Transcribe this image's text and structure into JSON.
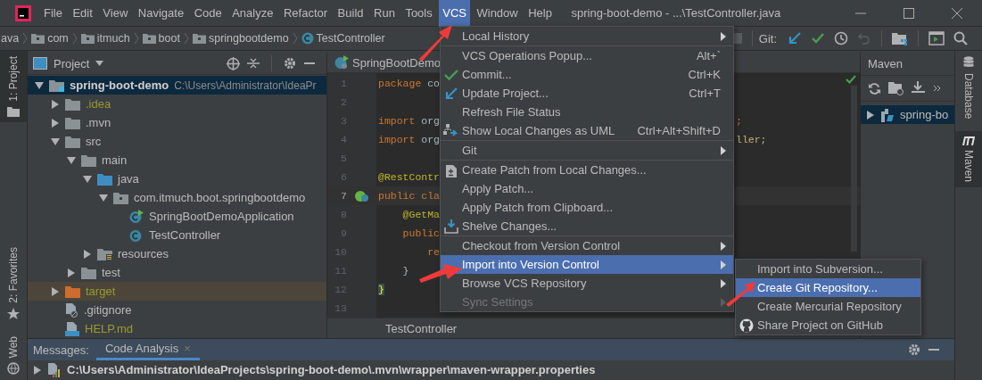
{
  "window": {
    "title": "spring-boot-demo - ...\\TestController.java"
  },
  "menu_bar": [
    {
      "label": "File",
      "selected": false
    },
    {
      "label": "Edit",
      "selected": false
    },
    {
      "label": "View",
      "selected": false
    },
    {
      "label": "Navigate",
      "selected": false
    },
    {
      "label": "Code",
      "selected": false
    },
    {
      "label": "Analyze",
      "selected": false
    },
    {
      "label": "Refactor",
      "selected": false
    },
    {
      "label": "Build",
      "selected": false
    },
    {
      "label": "Run",
      "selected": false
    },
    {
      "label": "Tools",
      "selected": false
    },
    {
      "label": "VCS",
      "selected": true
    },
    {
      "label": "Window",
      "selected": false
    },
    {
      "label": "Help",
      "selected": false
    }
  ],
  "breadcrumb": [
    {
      "label": "ava",
      "kind": "text"
    },
    {
      "label": "com",
      "kind": "folder"
    },
    {
      "label": "itmuch",
      "kind": "folder"
    },
    {
      "label": "boot",
      "kind": "folder"
    },
    {
      "label": "springbootdemo",
      "kind": "folder"
    },
    {
      "label": "TestController",
      "kind": "class"
    }
  ],
  "toolbar": {
    "git_label": "Git:"
  },
  "left_stripe": [
    {
      "label": "1: Project",
      "selected": true,
      "kind": "project"
    },
    {
      "label": "2: Favorites",
      "selected": false,
      "kind": "favorites"
    },
    {
      "label": "Web",
      "selected": false,
      "kind": "web"
    }
  ],
  "project": {
    "title": "Project",
    "tree": [
      {
        "label": "spring-boot-demo",
        "path": "C:\\Users\\Administrator\\IdeaPr",
        "kind": "module",
        "expanded": true,
        "selected": true,
        "ignored": false,
        "children": [
          {
            "label": ".idea",
            "kind": "folder",
            "expanded": false,
            "selected": false,
            "ignored": true
          },
          {
            "label": ".mvn",
            "kind": "folder",
            "expanded": false,
            "selected": false,
            "ignored": false
          },
          {
            "label": "src",
            "kind": "folder",
            "expanded": true,
            "selected": false,
            "ignored": false,
            "children": [
              {
                "label": "main",
                "kind": "folder",
                "expanded": true,
                "selected": false,
                "ignored": false,
                "children": [
                  {
                    "label": "java",
                    "kind": "source-folder",
                    "expanded": true,
                    "selected": false,
                    "ignored": false,
                    "children": [
                      {
                        "label": "com.itmuch.boot.springbootdemo",
                        "kind": "package",
                        "expanded": true,
                        "selected": false,
                        "ignored": false,
                        "children": [
                          {
                            "label": "SpringBootDemoApplication",
                            "kind": "spring-class",
                            "selected": false,
                            "ignored": false
                          },
                          {
                            "label": "TestController",
                            "kind": "class",
                            "selected": false,
                            "ignored": false
                          }
                        ]
                      }
                    ]
                  },
                  {
                    "label": "resources",
                    "kind": "resources-folder",
                    "expanded": false,
                    "selected": false,
                    "ignored": false
                  }
                ]
              },
              {
                "label": "test",
                "kind": "folder",
                "expanded": false,
                "selected": false,
                "ignored": false
              }
            ]
          },
          {
            "label": "target",
            "kind": "excluded-folder",
            "expanded": false,
            "selected": false,
            "ignored": true
          },
          {
            "label": ".gitignore",
            "kind": "file",
            "selected": false,
            "ignored": false
          },
          {
            "label": "HELP.md",
            "kind": "md-file",
            "selected": false,
            "ignored": true
          }
        ]
      }
    ]
  },
  "editor": {
    "tab": "SpringBootDemo",
    "lines": [
      {
        "number": "1",
        "current": false,
        "segments": [
          {
            "text": "package ",
            "kind": "keyword"
          },
          {
            "text": "co",
            "kind": "plain"
          }
        ]
      },
      {
        "number": "2",
        "current": false
      },
      {
        "number": "3",
        "current": false,
        "segments": [
          {
            "text": "import ",
            "kind": "keyword"
          },
          {
            "text": "org",
            "kind": "plain"
          }
        ],
        "tail": {
          "text": ";",
          "kind": "keyword"
        }
      },
      {
        "number": "4",
        "current": false,
        "segments": [
          {
            "text": "import ",
            "kind": "keyword"
          },
          {
            "text": "org",
            "kind": "plain"
          }
        ],
        "tail": {
          "text": "ller;",
          "kind": "unused"
        }
      },
      {
        "number": "5",
        "current": false
      },
      {
        "number": "6",
        "current": false,
        "segments": [
          {
            "text": "@RestContr",
            "kind": "annotation"
          }
        ]
      },
      {
        "number": "7",
        "current": true,
        "bean": true,
        "segments": [
          {
            "text": "public cla",
            "kind": "keyword"
          }
        ]
      },
      {
        "number": "8",
        "current": false,
        "bean": false,
        "segments": [
          {
            "text": "    @GetMa",
            "kind": "annotation"
          }
        ]
      },
      {
        "number": "9",
        "current": false,
        "segments": [
          {
            "text": "    public",
            "kind": "keyword"
          }
        ]
      },
      {
        "number": "10",
        "current": false,
        "segments": [
          {
            "text": "        re",
            "kind": "keyword"
          }
        ]
      },
      {
        "number": "11",
        "current": false,
        "segments": [
          {
            "text": "    }",
            "kind": "plain"
          }
        ]
      },
      {
        "number": "12",
        "current": false,
        "segments": [
          {
            "text": "}",
            "kind": "brace-match"
          }
        ]
      },
      {
        "number": "13",
        "current": false
      }
    ],
    "breadcrumb": "TestController"
  },
  "maven": {
    "title": "Maven",
    "tree": [
      {
        "label": "spring-bo",
        "expanded": false,
        "selected": true
      }
    ]
  },
  "right_stripe": [
    {
      "label": "Database",
      "selected": false,
      "kind": "database"
    },
    {
      "label": "Maven",
      "selected": true,
      "kind": "maven"
    }
  ],
  "bottom_panel": {
    "label": "Messages:",
    "tabs": [
      {
        "label": "Code Analysis",
        "selected": true,
        "close": "×"
      }
    ],
    "rows": [
      {
        "text": "C:\\Users\\Administrator\\IdeaProjects\\spring-boot-demo\\.mvn\\wrapper\\maven-wrapper.properties",
        "expanded": false
      }
    ]
  },
  "vcs_menu": {
    "groups": [
      [
        {
          "label": "Local History",
          "submenu": true,
          "selected": false,
          "disabled": false,
          "kind": "plain"
        }
      ],
      [
        {
          "label": "VCS Operations Popup...",
          "shortcut": "Alt+`",
          "submenu": false,
          "selected": false,
          "disabled": false,
          "kind": "plain"
        },
        {
          "label": "Commit...",
          "shortcut": "Ctrl+K",
          "submenu": false,
          "selected": false,
          "disabled": false,
          "kind": "check"
        },
        {
          "label": "Update Project...",
          "shortcut": "Ctrl+T",
          "submenu": false,
          "selected": false,
          "disabled": false,
          "kind": "update"
        },
        {
          "label": "Refresh File Status",
          "submenu": false,
          "selected": false,
          "disabled": false,
          "kind": "plain"
        },
        {
          "label": "Show Local Changes as UML",
          "shortcut": "Ctrl+Alt+Shift+D",
          "submenu": false,
          "selected": false,
          "disabled": false,
          "kind": "uml"
        }
      ],
      [
        {
          "label": "Git",
          "submenu": true,
          "selected": false,
          "disabled": false,
          "kind": "plain"
        }
      ],
      [
        {
          "label": "Create Patch from Local Changes...",
          "submenu": false,
          "selected": false,
          "disabled": false,
          "kind": "patch"
        },
        {
          "label": "Apply Patch...",
          "submenu": false,
          "selected": false,
          "disabled": false,
          "kind": "plain"
        },
        {
          "label": "Apply Patch from Clipboard...",
          "submenu": false,
          "selected": false,
          "disabled": false,
          "kind": "plain"
        },
        {
          "label": "Shelve Changes...",
          "submenu": false,
          "selected": false,
          "disabled": false,
          "kind": "shelve"
        }
      ],
      [
        {
          "label": "Checkout from Version Control",
          "submenu": true,
          "selected": false,
          "disabled": false,
          "kind": "plain"
        },
        {
          "label": "Import into Version Control",
          "submenu": true,
          "selected": true,
          "disabled": false,
          "kind": "plain"
        },
        {
          "label": "Browse VCS Repository",
          "submenu": true,
          "selected": false,
          "disabled": false,
          "kind": "plain"
        },
        {
          "label": "Sync Settings",
          "submenu": true,
          "selected": false,
          "disabled": true,
          "kind": "plain"
        }
      ]
    ]
  },
  "submenu": [
    {
      "label": "Import into Subversion...",
      "selected": false,
      "kind": "plain"
    },
    {
      "label": "Create Git Repository...",
      "selected": true,
      "kind": "plain"
    },
    {
      "label": "Create Mercurial Repository",
      "selected": false,
      "kind": "plain"
    },
    {
      "label": "Share Project on GitHub",
      "selected": false,
      "kind": "github"
    }
  ]
}
